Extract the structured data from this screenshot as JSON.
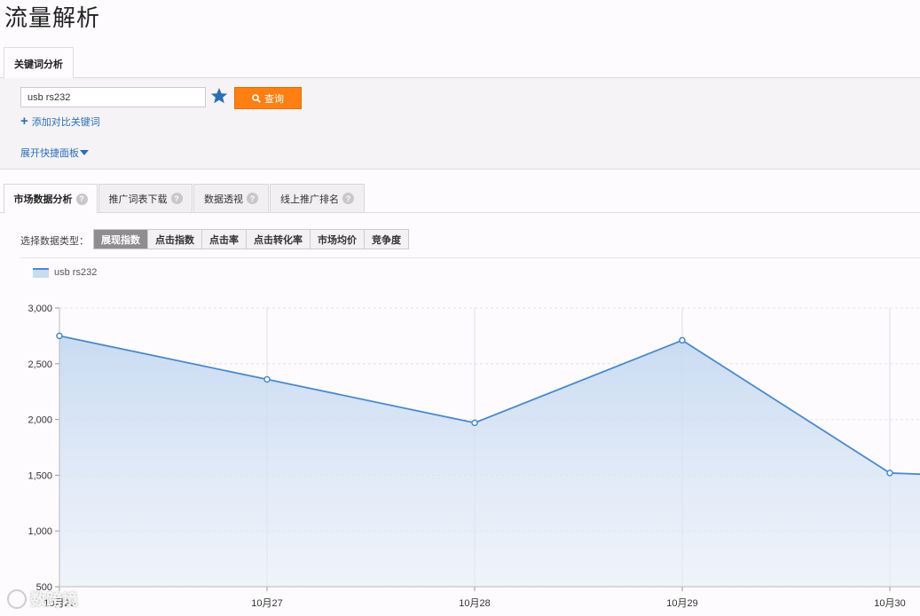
{
  "page": {
    "title": "流量解析"
  },
  "top_tab": {
    "label": "关键词分析"
  },
  "search": {
    "value": "usb rs232",
    "query_label": "查询",
    "add_compare_label": "添加对比关键词",
    "expand_panel_label": "展开快捷面板"
  },
  "tabs": [
    {
      "label": "市场数据分析",
      "active": true
    },
    {
      "label": "推广词表下载",
      "active": false
    },
    {
      "label": "数据透视",
      "active": false
    },
    {
      "label": "线上推广排名",
      "active": false
    }
  ],
  "data_type": {
    "label": "选择数据类型：",
    "options": [
      "展现指数",
      "点击指数",
      "点击率",
      "点击转化率",
      "市场均价",
      "竞争度"
    ],
    "selected": "展现指数"
  },
  "watermark": "数跨境",
  "colors": {
    "accent": "#ff7f12",
    "link": "#2b6fb6",
    "series_line": "#4a8acb",
    "series_fill": "#c8dbf1"
  },
  "chart_data": {
    "type": "area",
    "x": [
      "10月26",
      "10月27",
      "10月28",
      "10月29",
      "10月30",
      ""
    ],
    "series": [
      {
        "name": "usb rs232",
        "values": [
          2750,
          2360,
          1970,
          2710,
          1520,
          1450
        ]
      }
    ],
    "ylim": [
      500,
      3000
    ],
    "yticks": [
      500,
      1000,
      1500,
      2000,
      2500,
      3000
    ],
    "ytick_labels": [
      "500",
      "1,000",
      "1,500",
      "2,000",
      "2,500",
      "3,000"
    ],
    "grid": true,
    "legend": "top-left"
  }
}
